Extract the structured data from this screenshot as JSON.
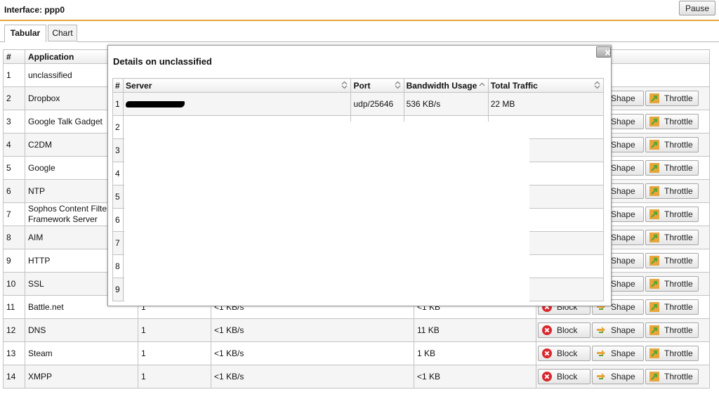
{
  "header": {
    "title": "Interface: ppp0",
    "pause_label": "Pause"
  },
  "tabs": [
    {
      "label": "Tabular"
    },
    {
      "label": "Chart"
    }
  ],
  "main_table": {
    "columns": [
      "#",
      "Application"
    ],
    "rows": [
      {
        "num": "1",
        "app": "unclassified",
        "c3": "",
        "c4": "",
        "c5": "",
        "actions": false
      },
      {
        "num": "2",
        "app": "Dropbox",
        "c3": "",
        "c4": "",
        "c5": "",
        "actions": true
      },
      {
        "num": "3",
        "app": "Google Talk Gadget",
        "c3": "",
        "c4": "",
        "c5": "",
        "actions": true
      },
      {
        "num": "4",
        "app": "C2DM",
        "c3": "",
        "c4": "",
        "c5": "",
        "actions": true
      },
      {
        "num": "5",
        "app": "Google",
        "c3": "",
        "c4": "",
        "c5": "",
        "actions": true
      },
      {
        "num": "6",
        "app": "NTP",
        "c3": "",
        "c4": "",
        "c5": "",
        "actions": true
      },
      {
        "num": "7",
        "app": "Sophos Content Filter Framework Server",
        "c3": "",
        "c4": "",
        "c5": "",
        "actions": true
      },
      {
        "num": "8",
        "app": "AIM",
        "c3": "",
        "c4": "",
        "c5": "",
        "actions": true
      },
      {
        "num": "9",
        "app": "HTTP",
        "c3": "",
        "c4": "",
        "c5": "",
        "actions": true
      },
      {
        "num": "10",
        "app": "SSL",
        "c3": "",
        "c4": "",
        "c5": "",
        "actions": true
      },
      {
        "num": "11",
        "app": "Battle.net",
        "c3": "1",
        "c4": "<1 KB/s",
        "c5": "<1 KB",
        "actions": true
      },
      {
        "num": "12",
        "app": "DNS",
        "c3": "1",
        "c4": "<1 KB/s",
        "c5": "11 KB",
        "actions": true
      },
      {
        "num": "13",
        "app": "Steam",
        "c3": "1",
        "c4": "<1 KB/s",
        "c5": "1 KB",
        "actions": true
      },
      {
        "num": "14",
        "app": "XMPP",
        "c3": "1",
        "c4": "<1 KB/s",
        "c5": "<1 KB",
        "actions": true
      }
    ],
    "actions": {
      "block": "Block",
      "shape": "Shape",
      "throttle": "Throttle"
    }
  },
  "modal": {
    "title": "Details on unclassified",
    "columns": [
      "#",
      "Server",
      "Port",
      "Bandwidth Usage",
      "Total Traffic"
    ],
    "rows": [
      {
        "num": "1",
        "server": "",
        "port": "udp/25646",
        "bandwidth": "536 KB/s",
        "traffic": "22 MB"
      },
      {
        "num": "2",
        "server": "",
        "port": "",
        "bandwidth": "",
        "traffic": ""
      },
      {
        "num": "3",
        "server": "",
        "port": "",
        "bandwidth": "",
        "traffic": ""
      },
      {
        "num": "4",
        "server": "",
        "port": "",
        "bandwidth": "",
        "traffic": ""
      },
      {
        "num": "5",
        "server": "",
        "port": "",
        "bandwidth": "",
        "traffic": ""
      },
      {
        "num": "6",
        "server": "",
        "port": "",
        "bandwidth": "",
        "traffic": ""
      },
      {
        "num": "7",
        "server": "",
        "port": "",
        "bandwidth": "",
        "traffic": ""
      },
      {
        "num": "8",
        "server": "",
        "port": "",
        "bandwidth": "",
        "traffic": ""
      },
      {
        "num": "9",
        "server": "",
        "port": "",
        "bandwidth": "",
        "traffic": ""
      }
    ]
  },
  "colors": {
    "accent_line": "#e8a53a",
    "block_icon": "#d9262c",
    "throttle_icon": "#5aa632"
  }
}
